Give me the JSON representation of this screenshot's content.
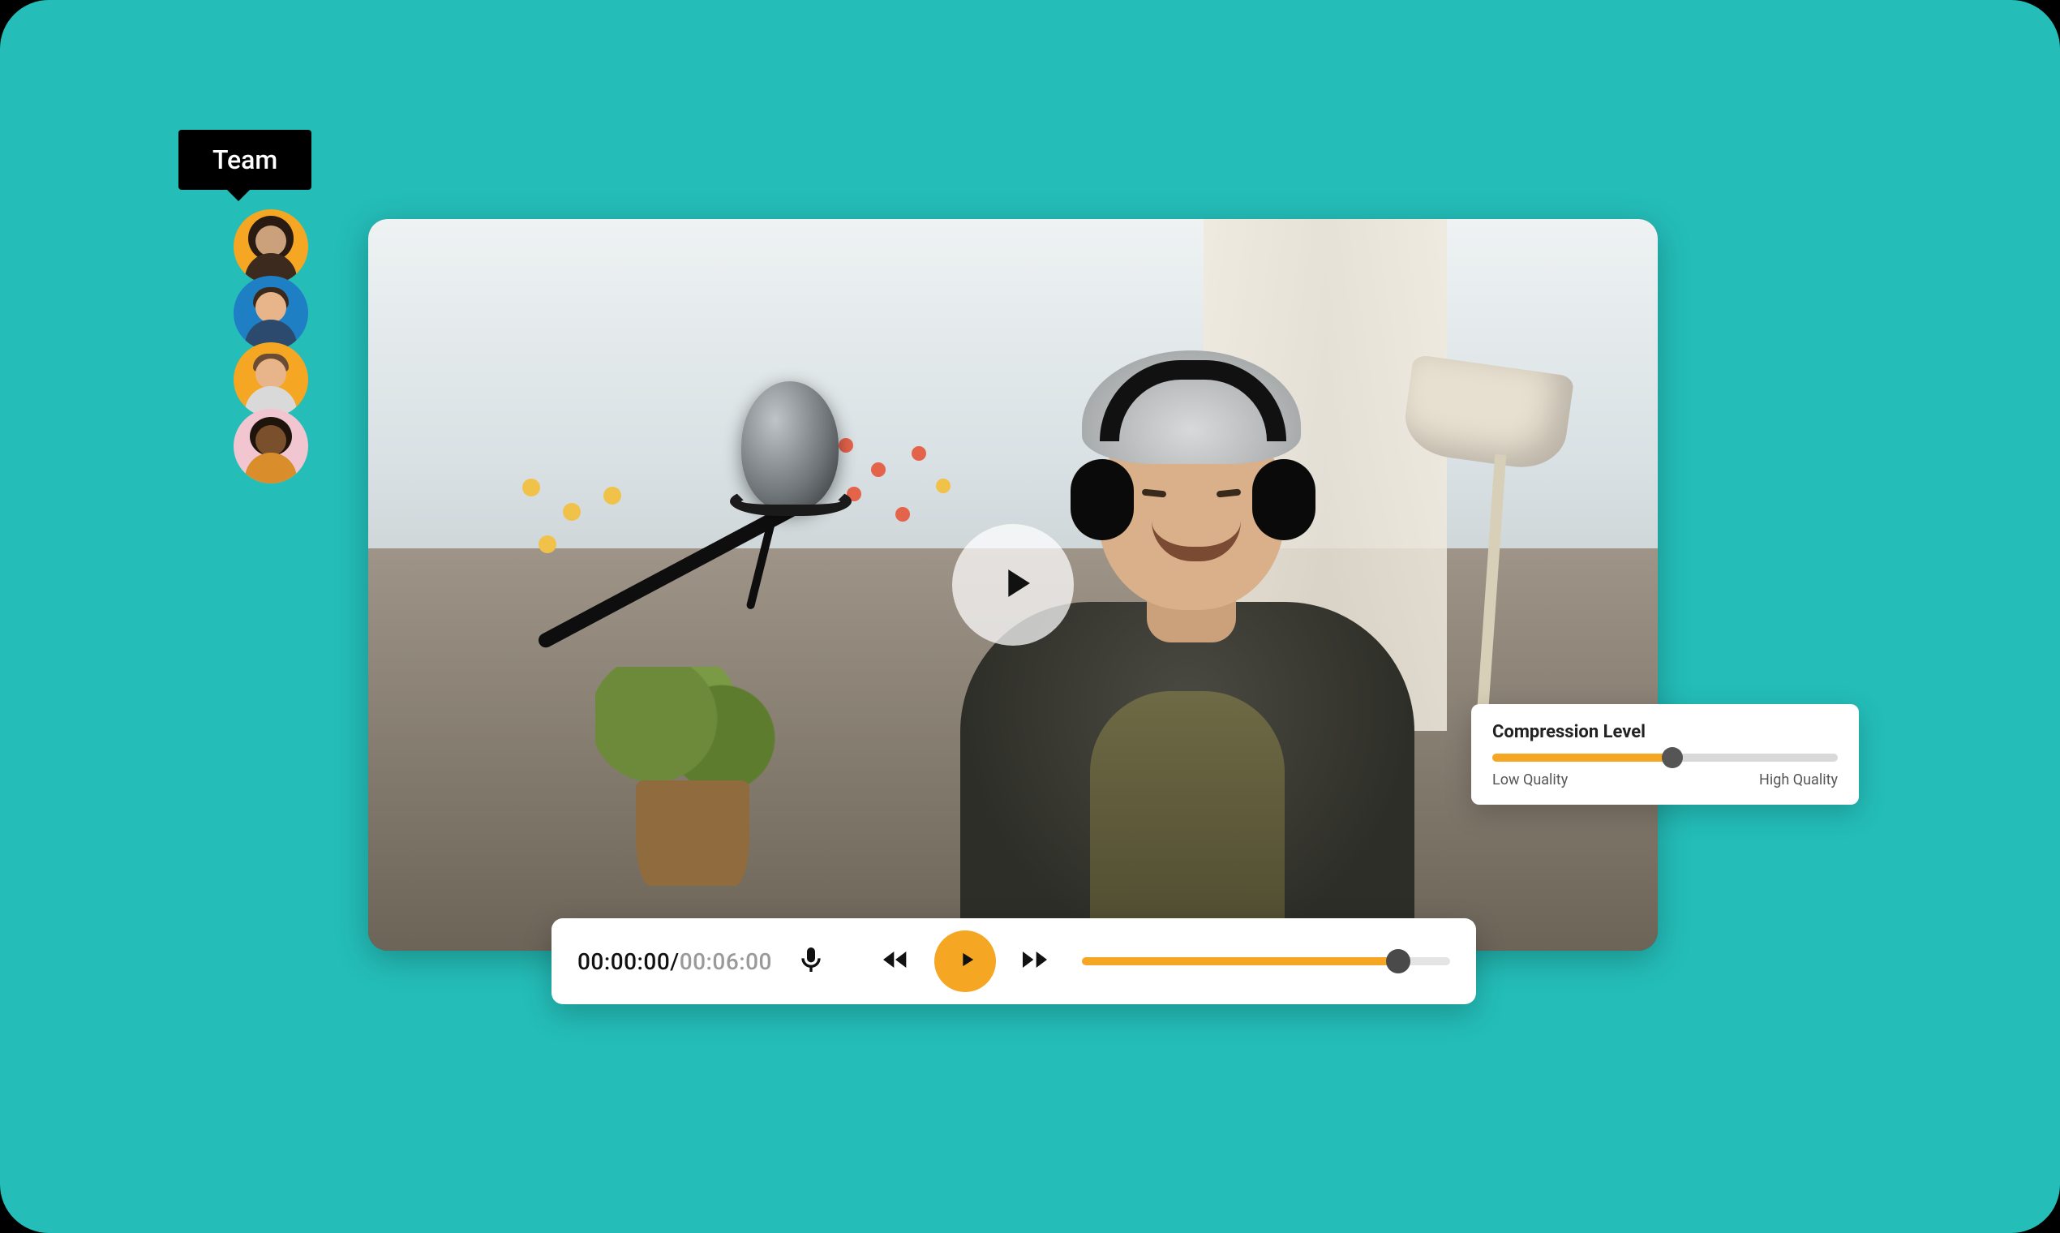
{
  "team": {
    "label": "Team",
    "members": 4
  },
  "avatars": [
    {
      "bg": "#f5a623"
    },
    {
      "bg": "#1f7fc4"
    },
    {
      "bg": "#f5a623"
    },
    {
      "bg": "#f2c6d0"
    }
  ],
  "compression": {
    "title": "Compression Level",
    "low_label": "Low Quality",
    "high_label": "High Quality",
    "percent": 52
  },
  "player": {
    "current_time": "00:00:00",
    "duration": "00:06:00",
    "separator": "/",
    "progress_percent": 86
  },
  "colors": {
    "accent": "#f5a623",
    "background": "#24bdb8"
  }
}
